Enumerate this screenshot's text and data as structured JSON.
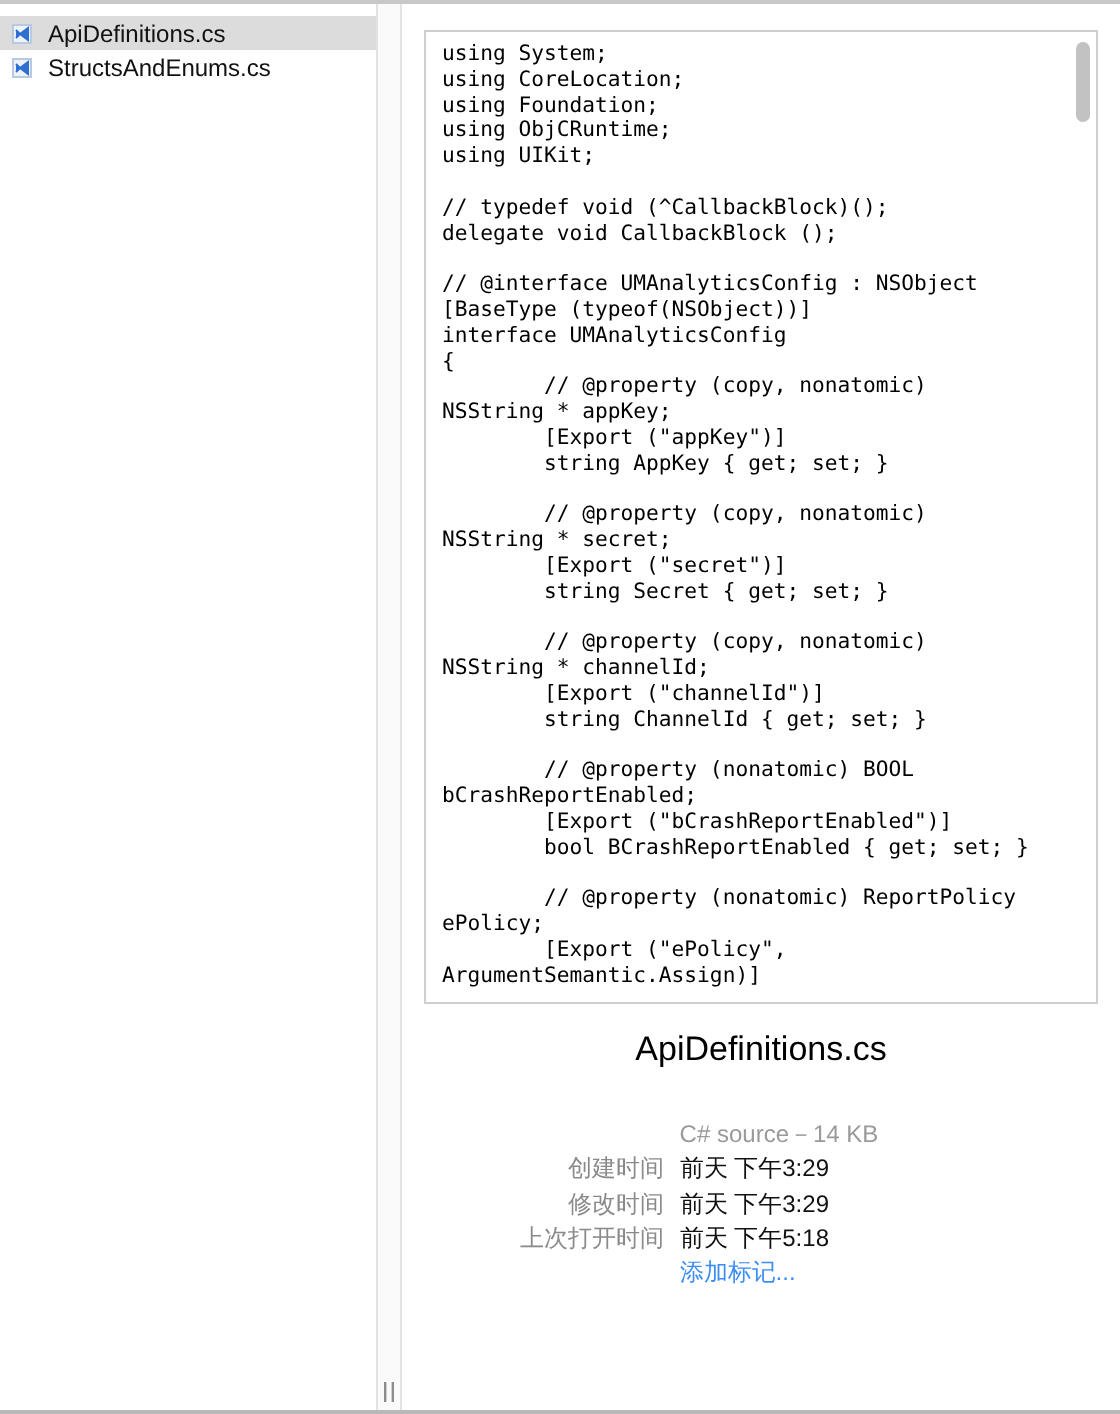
{
  "sidebar": {
    "items": [
      {
        "label": "ApiDefinitions.cs",
        "selected": true
      },
      {
        "label": "StructsAndEnums.cs",
        "selected": false
      }
    ]
  },
  "preview": {
    "code_blocks": [
      [
        "using System;",
        "using CoreLocation;",
        "using Foundation;",
        "using ObjCRuntime;",
        "using UIKit;"
      ],
      [
        "// typedef void (^CallbackBlock)();",
        "delegate void CallbackBlock ();"
      ],
      [
        "// @interface UMAnalyticsConfig : NSObject",
        "[BaseType (typeof(NSObject))]",
        "interface UMAnalyticsConfig",
        "{",
        "        // @property (copy, nonatomic)",
        "NSString * appKey;",
        "        [Export (\"appKey\")]",
        "        string AppKey { get; set; }"
      ],
      [
        "        // @property (copy, nonatomic)",
        "NSString * secret;",
        "        [Export (\"secret\")]",
        "        string Secret { get; set; }"
      ],
      [
        "        // @property (copy, nonatomic)",
        "NSString * channelId;",
        "        [Export (\"channelId\")]",
        "        string ChannelId { get; set; }"
      ],
      [
        "        // @property (nonatomic) BOOL",
        "bCrashReportEnabled;",
        "        [Export (\"bCrashReportEnabled\")]",
        "        bool BCrashReportEnabled { get; set; }"
      ],
      [
        "        // @property (nonatomic) ReportPolicy",
        "ePolicy;",
        "        [Export (\"ePolicy\",",
        "ArgumentSemantic.Assign)]"
      ]
    ]
  },
  "info": {
    "file_name": "ApiDefinitions.cs",
    "kind_size": "C# source－14 KB",
    "rows": [
      {
        "label": "创建时间",
        "value": "前天 下午3:29"
      },
      {
        "label": "修改时间",
        "value": "前天 下午3:29"
      },
      {
        "label": "上次打开时间",
        "value": "前天 下午5:18"
      }
    ],
    "add_tags_link": "添加标记..."
  }
}
